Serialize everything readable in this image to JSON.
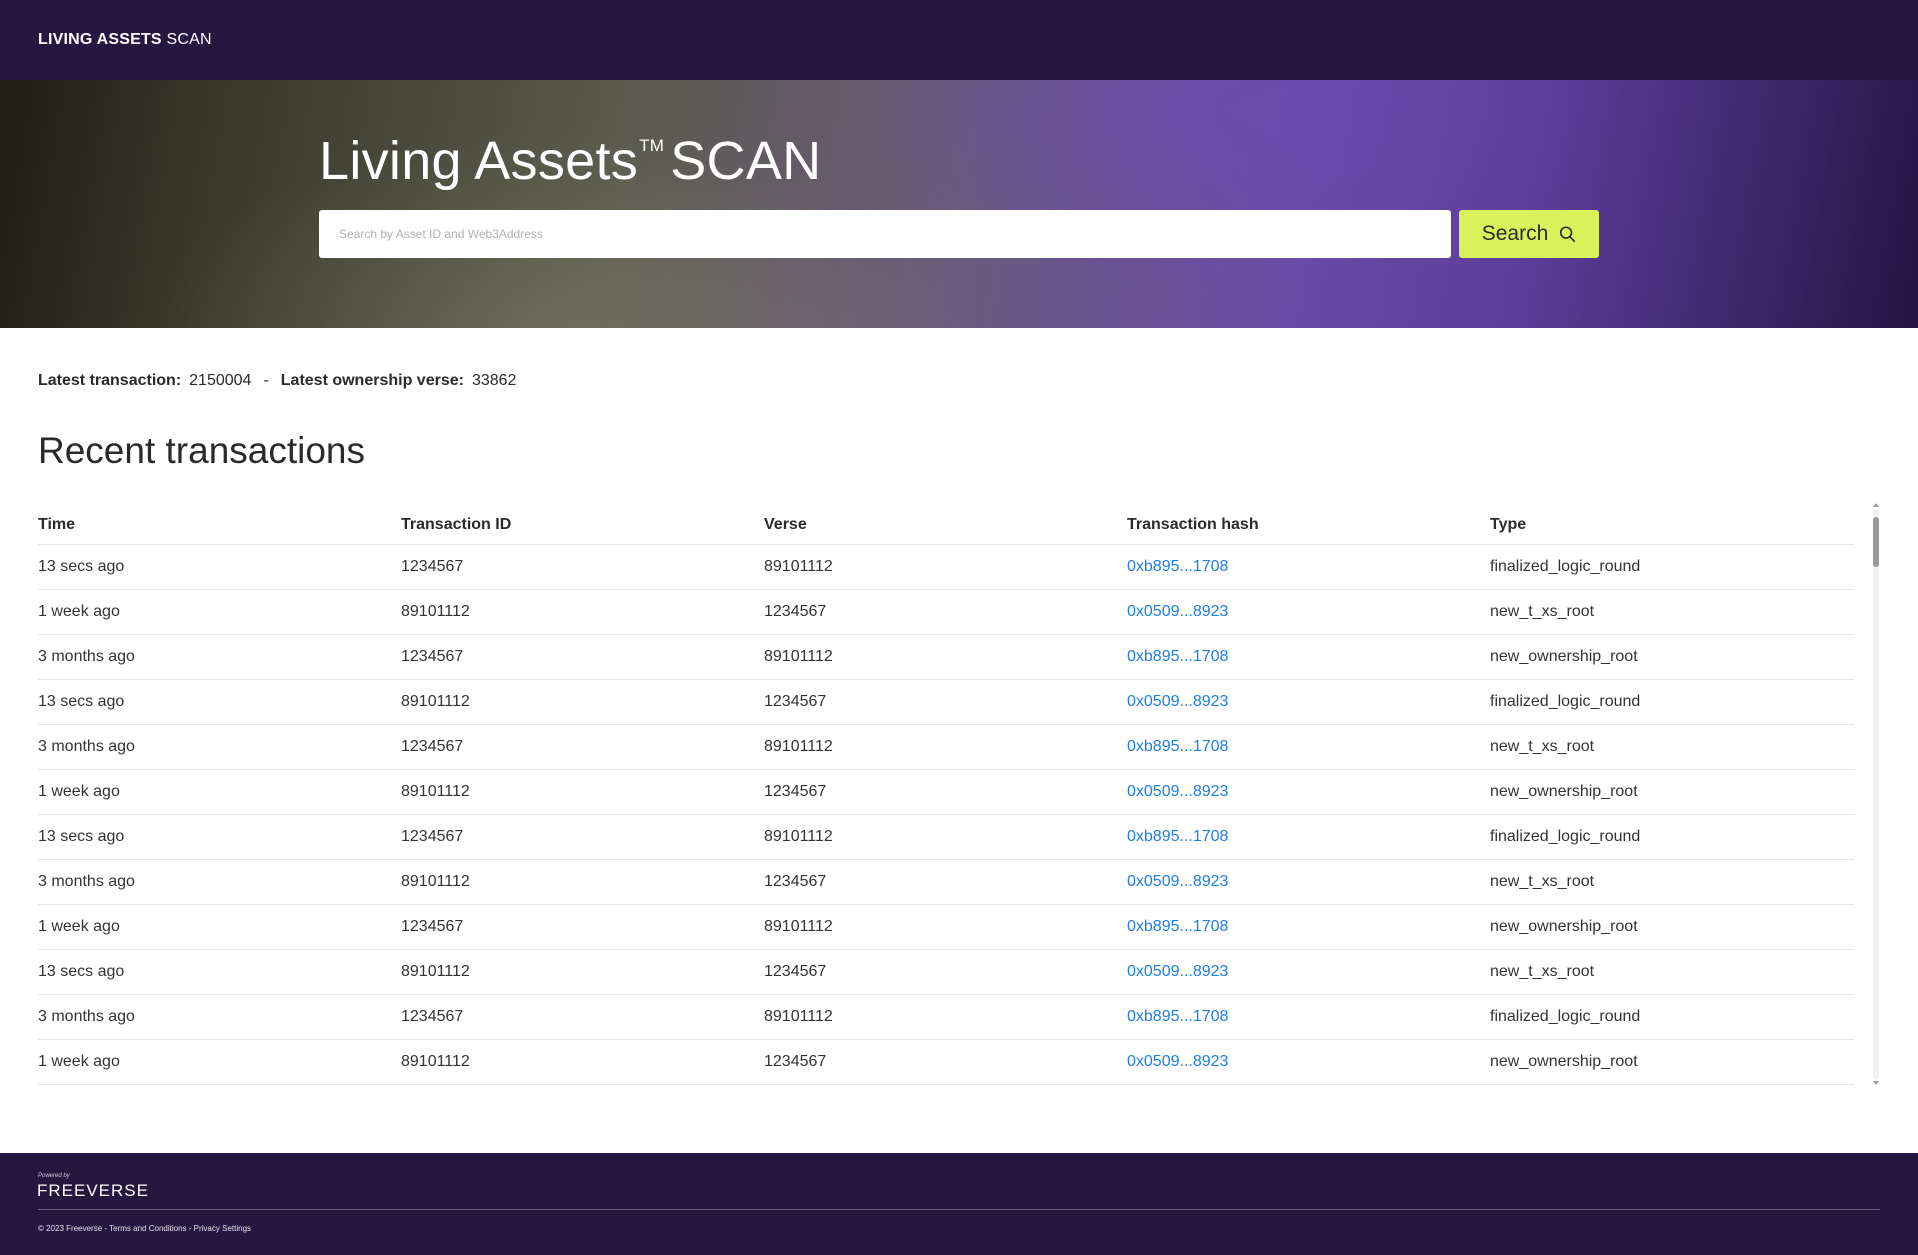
{
  "header": {
    "brand_bold": "LIVING ASSETS",
    "brand_light": "SCAN"
  },
  "hero": {
    "title_main": "Living Assets",
    "title_tm": "TM",
    "title_suffix": "SCAN",
    "search_placeholder": "Search by Asset ID and Web3Address",
    "search_value": "",
    "search_button": "Search",
    "search_icon": "search-icon"
  },
  "stats": {
    "latest_transaction_label": "Latest transaction:",
    "latest_transaction_value": "2150004",
    "separator": "-",
    "latest_verse_label": "Latest ownership verse:",
    "latest_verse_value": "33862"
  },
  "transactions": {
    "title": "Recent transactions",
    "columns": [
      "Time",
      "Transaction ID",
      "Verse",
      "Transaction hash",
      "Type"
    ],
    "rows": [
      {
        "time": "13 secs ago",
        "id": "1234567",
        "verse": "89101112",
        "hash": "0xb895...1708",
        "type": "finalized_logic_round"
      },
      {
        "time": "1 week ago",
        "id": "89101112",
        "verse": "1234567",
        "hash": "0x0509...8923",
        "type": "new_t_xs_root"
      },
      {
        "time": "3 months ago",
        "id": "1234567",
        "verse": "89101112",
        "hash": "0xb895...1708",
        "type": "new_ownership_root"
      },
      {
        "time": "13 secs ago",
        "id": "89101112",
        "verse": "1234567",
        "hash": "0x0509...8923",
        "type": "finalized_logic_round"
      },
      {
        "time": "3 months ago",
        "id": "1234567",
        "verse": "89101112",
        "hash": "0xb895...1708",
        "type": "new_t_xs_root"
      },
      {
        "time": "1 week ago",
        "id": "89101112",
        "verse": "1234567",
        "hash": "0x0509...8923",
        "type": "new_ownership_root"
      },
      {
        "time": "13 secs ago",
        "id": "1234567",
        "verse": "89101112",
        "hash": "0xb895...1708",
        "type": "finalized_logic_round"
      },
      {
        "time": "3 months ago",
        "id": "89101112",
        "verse": "1234567",
        "hash": "0x0509...8923",
        "type": "new_t_xs_root"
      },
      {
        "time": "1 week ago",
        "id": "1234567",
        "verse": "89101112",
        "hash": "0xb895...1708",
        "type": "new_ownership_root"
      },
      {
        "time": "13 secs ago",
        "id": "89101112",
        "verse": "1234567",
        "hash": "0x0509...8923",
        "type": "new_t_xs_root"
      },
      {
        "time": "3 months ago",
        "id": "1234567",
        "verse": "89101112",
        "hash": "0xb895...1708",
        "type": "finalized_logic_round"
      },
      {
        "time": "1 week ago",
        "id": "89101112",
        "verse": "1234567",
        "hash": "0x0509...8923",
        "type": "new_ownership_root"
      }
    ]
  },
  "footer": {
    "powered_by": "Powered by",
    "logo_text": "FREEVERSE",
    "copyright": "© 2023 Freeverse",
    "sep1": "-",
    "terms": "Terms and Conditions",
    "sep2": "-",
    "privacy": "Privacy Settings"
  },
  "colors": {
    "topbar": "#261740",
    "accent_button": "#d9f25a",
    "link": "#1f7ee0",
    "text": "#2a2a2a"
  }
}
